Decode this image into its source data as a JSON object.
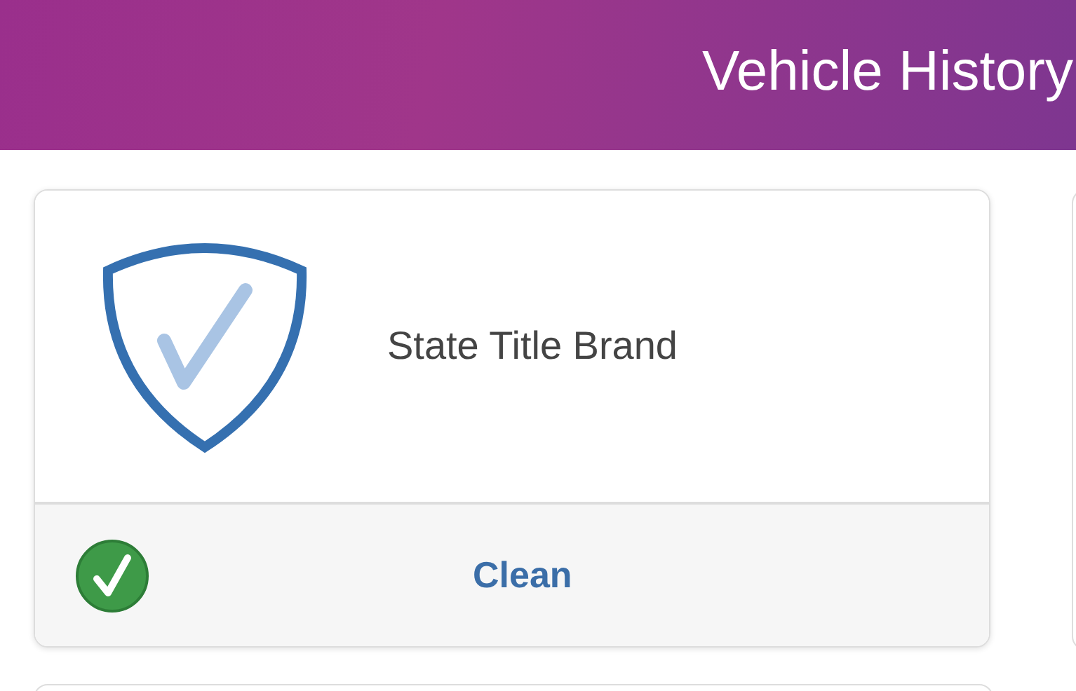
{
  "header": {
    "title": "Vehicle History"
  },
  "cards": [
    {
      "title": "State Title Brand",
      "status": "Clean",
      "passed": true
    }
  ]
}
